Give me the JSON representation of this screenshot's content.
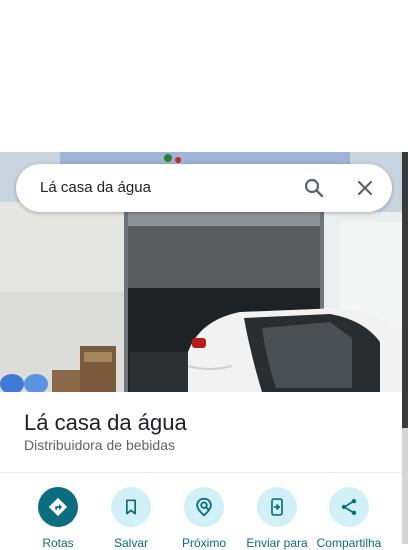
{
  "search": {
    "query": "Lá casa da água"
  },
  "place": {
    "name": "Lá casa da água",
    "category": "Distribuidora de bebidas"
  },
  "actions": [
    {
      "label": "Rotas",
      "icon": "directions-icon"
    },
    {
      "label": "Salvar",
      "icon": "bookmark-icon"
    },
    {
      "label": "Próximo",
      "icon": "nearby-icon"
    },
    {
      "label": "Enviar para",
      "icon": "send-to-phone-icon"
    },
    {
      "label": "Compartilha",
      "icon": "share-icon"
    }
  ],
  "colors": {
    "accent": "#0b6e80",
    "action_bg": "#d2f0f7"
  }
}
